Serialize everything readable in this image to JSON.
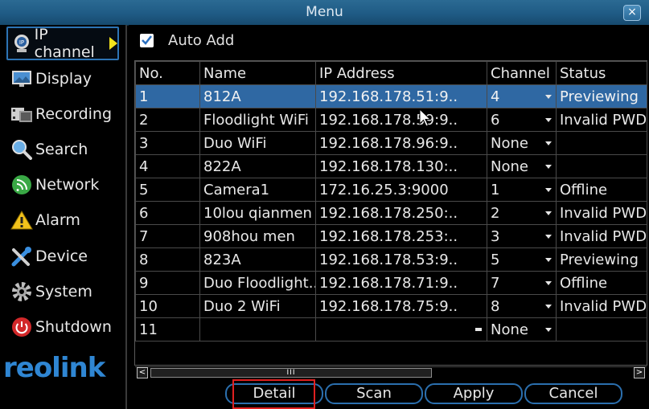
{
  "window": {
    "title": "Menu",
    "close_label": "×"
  },
  "sidebar": {
    "items": [
      {
        "label": "IP channel",
        "icon": "ip-camera-icon",
        "active": true
      },
      {
        "label": "Display",
        "icon": "monitor-icon"
      },
      {
        "label": "Recording",
        "icon": "recording-icon"
      },
      {
        "label": "Search",
        "icon": "search-icon"
      },
      {
        "label": "Network",
        "icon": "network-icon"
      },
      {
        "label": "Alarm",
        "icon": "alarm-icon"
      },
      {
        "label": "Device",
        "icon": "device-tools-icon"
      },
      {
        "label": "System",
        "icon": "gear-icon"
      },
      {
        "label": "Shutdown",
        "icon": "power-icon"
      }
    ],
    "logo_text": "reolink"
  },
  "auto_add": {
    "label": "Auto Add",
    "checked": true
  },
  "table": {
    "headers": {
      "no": "No.",
      "name": "Name",
      "ip": "IP Address",
      "channel": "Channel",
      "status": "Status"
    },
    "rows": [
      {
        "no": "1",
        "name": "812A",
        "ip": "192.168.178.51:9..",
        "channel": "4",
        "status": "Previewing"
      },
      {
        "no": "2",
        "name": "Floodlight WiFi",
        "ip": "192.168.178.59:9..",
        "channel": "6",
        "status": "Invalid PWD"
      },
      {
        "no": "3",
        "name": "Duo WiFi",
        "ip": "192.168.178.96:9..",
        "channel": "None",
        "status": ""
      },
      {
        "no": "4",
        "name": "822A",
        "ip": "192.168.178.130:..",
        "channel": "None",
        "status": ""
      },
      {
        "no": "5",
        "name": "Camera1",
        "ip": "172.16.25.3:9000",
        "channel": "1",
        "status": "Offline"
      },
      {
        "no": "6",
        "name": "10lou qianmen",
        "ip": "192.168.178.250:..",
        "channel": "2",
        "status": "Invalid PWD"
      },
      {
        "no": "7",
        "name": "908hou men",
        "ip": "192.168.178.253:..",
        "channel": "3",
        "status": "Invalid PWD"
      },
      {
        "no": "8",
        "name": "823A",
        "ip": "192.168.178.53:9..",
        "channel": "5",
        "status": "Previewing"
      },
      {
        "no": "9",
        "name": "Duo Floodlight..",
        "ip": "192.168.178.71:9..",
        "channel": "7",
        "status": "Offline"
      },
      {
        "no": "10",
        "name": "Duo 2 WiFi",
        "ip": "192.168.178.75:9..",
        "channel": "8",
        "status": "Invalid PWD"
      },
      {
        "no": "11",
        "name": "",
        "ip": "",
        "channel": "None",
        "status": ""
      }
    ],
    "selected_row": 1
  },
  "scrollbar": {
    "left": "<",
    "right": ">",
    "thumb": "III"
  },
  "buttons": {
    "detail": "Detail",
    "scan": "Scan",
    "apply": "Apply",
    "cancel": "Cancel"
  },
  "colors": {
    "accent": "#2f68a3",
    "title_bar": "#1f5b85",
    "highlight": "#e02020",
    "arrow": "#f1e21b"
  }
}
